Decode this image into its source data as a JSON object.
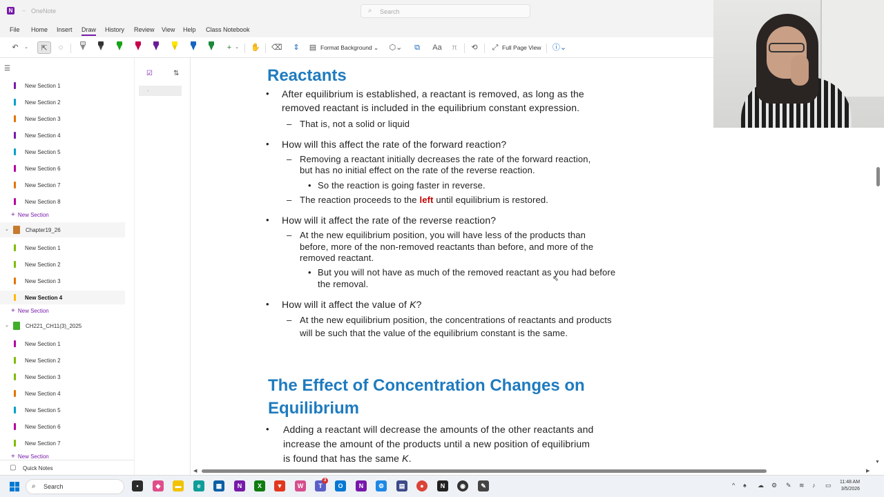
{
  "app": {
    "title": "OneNote",
    "search_placeholder": "Search"
  },
  "menu": {
    "items": [
      "File",
      "Home",
      "Insert",
      "Draw",
      "History",
      "Review",
      "View",
      "Help",
      "Class Notebook"
    ],
    "active": "Draw"
  },
  "toolbar": {
    "format_background": "Format Background",
    "full_page_view": "Full Page View"
  },
  "sidebar": {
    "group1": [
      "New Section 1",
      "New Section 2",
      "New Section 3",
      "New Section 4",
      "New Section 5",
      "New Section 6",
      "New Section 7",
      "New Section 8"
    ],
    "add_section": "New Section",
    "notebook2": "Chapter19_26",
    "group2": [
      "New Section 1",
      "New Section 2",
      "New Section 3",
      "New Section 4"
    ],
    "notebook3": "CH221_CH11(3)_2025",
    "group3": [
      "New Section 1",
      "New Section 2",
      "New Section 3",
      "New Section 4",
      "New Section 5",
      "New Section 6",
      "New Section 7"
    ],
    "quick_notes": "Quick Notes",
    "colors": {
      "group1": [
        "#7719aa",
        "#00a0c8",
        "#e37300",
        "#7719aa",
        "#00a0c8",
        "#b4009e",
        "#e37300",
        "#b4009e"
      ],
      "group2": [
        "#7fba00",
        "#7fba00",
        "#e37300",
        "#ffb900"
      ],
      "group3": [
        "#b4009e",
        "#7fba00",
        "#7fba00",
        "#e37300",
        "#00a0c8",
        "#b4009e",
        "#7fba00"
      ],
      "notebook2": "#c77a2d",
      "notebook3": "#3fae29"
    }
  },
  "pagelist": {
    "page_item": "."
  },
  "note": {
    "heading1": "Reactants",
    "b1_l1": "After equilibrium is established, a reactant is removed, as long as the",
    "b1_l2": "removed reactant is included in the equilibrium constant expression.",
    "b1_s1": "That is, not a solid or liquid",
    "b2": "How will this affect the rate of the forward reaction?",
    "b2_s1_l1": "Removing a reactant initially decreases the rate of the forward reaction,",
    "b2_s1_l2": "but has no initial effect on the rate of the reverse reaction.",
    "b2_s1_ss": "So the reaction is going faster in reverse.",
    "b2_s2_pre": "The reaction proceeds to the ",
    "b2_s2_red": "left",
    "b2_s2_post": " until equilibrium is restored.",
    "b3": "How will it affect the rate of the reverse reaction?",
    "b3_s1_l1": "At the new equilibrium position, you will have less of the products than",
    "b3_s1_l2": "before, more of the non-removed reactants than before, and more of the",
    "b3_s1_l3": "removed reactant.",
    "b3_s1_ss_l1": "But you will not have as much of the removed reactant as you had before",
    "b3_s1_ss_l2": "the removal.",
    "b4_pre": "How will it affect the value of ",
    "b4_k": "K",
    "b4_post": "?",
    "b4_s1_l1": "At the new equilibrium position, the concentrations of reactants and products",
    "b4_s1_l2": "will be such that the value of the equilibrium constant is the same.",
    "heading2_l1": "The Effect of Concentration Changes on",
    "heading2_l2": "Equilibrium",
    "b5_l1": "Adding a reactant will decrease the amounts of the other reactants and",
    "b5_l2": "increase the amount of the products until a new position of equilibrium",
    "b5_l3_pre": "is found that has the same ",
    "b5_l3_k": "K",
    "b5_l3_post": "."
  },
  "taskbar": {
    "search_placeholder": "Search",
    "time": "11:48 AM",
    "date": "3/5/2026",
    "badge": "3"
  }
}
